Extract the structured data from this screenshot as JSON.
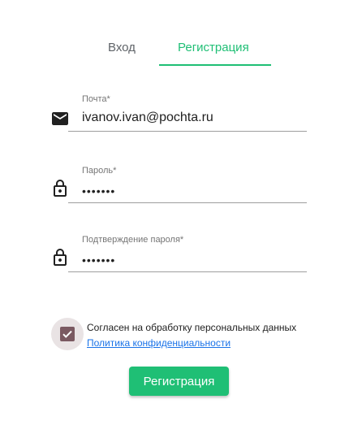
{
  "tabs": [
    {
      "label": "Вход",
      "active": false
    },
    {
      "label": "Регистрация",
      "active": true
    }
  ],
  "form": {
    "email": {
      "label": "Почта*",
      "value": "ivanov.ivan@pochta.ru",
      "icon": "mail-icon"
    },
    "password": {
      "label": "Пароль*",
      "value": "•••••••",
      "icon": "lock-icon"
    },
    "password_confirm": {
      "label": "Подтверждение пароля*",
      "value": "•••••••",
      "icon": "lock-icon"
    }
  },
  "consent": {
    "checked": true,
    "text": "Согласен на обработку персональных данных",
    "link": "Политика конфиденциальности"
  },
  "submit_label": "Регистрация",
  "colors": {
    "accent": "#1fbf75",
    "checkbox": "#7a5961",
    "link": "#1a73e8",
    "underline": "#9e9e9e"
  }
}
